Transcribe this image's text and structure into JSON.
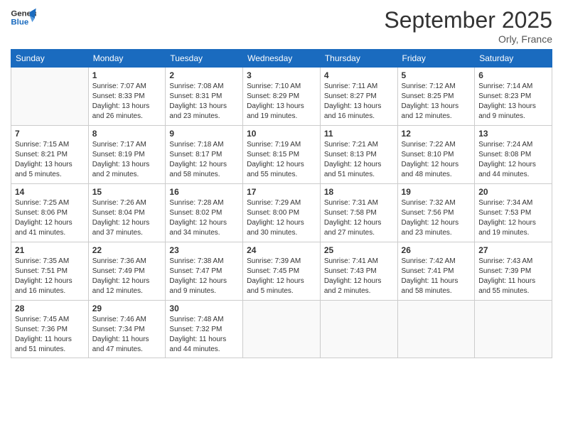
{
  "logo": {
    "line1": "General",
    "line2": "Blue"
  },
  "header": {
    "month": "September 2025",
    "location": "Orly, France"
  },
  "weekdays": [
    "Sunday",
    "Monday",
    "Tuesday",
    "Wednesday",
    "Thursday",
    "Friday",
    "Saturday"
  ],
  "weeks": [
    [
      {
        "day": "",
        "info": ""
      },
      {
        "day": "1",
        "info": "Sunrise: 7:07 AM\nSunset: 8:33 PM\nDaylight: 13 hours\nand 26 minutes."
      },
      {
        "day": "2",
        "info": "Sunrise: 7:08 AM\nSunset: 8:31 PM\nDaylight: 13 hours\nand 23 minutes."
      },
      {
        "day": "3",
        "info": "Sunrise: 7:10 AM\nSunset: 8:29 PM\nDaylight: 13 hours\nand 19 minutes."
      },
      {
        "day": "4",
        "info": "Sunrise: 7:11 AM\nSunset: 8:27 PM\nDaylight: 13 hours\nand 16 minutes."
      },
      {
        "day": "5",
        "info": "Sunrise: 7:12 AM\nSunset: 8:25 PM\nDaylight: 13 hours\nand 12 minutes."
      },
      {
        "day": "6",
        "info": "Sunrise: 7:14 AM\nSunset: 8:23 PM\nDaylight: 13 hours\nand 9 minutes."
      }
    ],
    [
      {
        "day": "7",
        "info": "Sunrise: 7:15 AM\nSunset: 8:21 PM\nDaylight: 13 hours\nand 5 minutes."
      },
      {
        "day": "8",
        "info": "Sunrise: 7:17 AM\nSunset: 8:19 PM\nDaylight: 13 hours\nand 2 minutes."
      },
      {
        "day": "9",
        "info": "Sunrise: 7:18 AM\nSunset: 8:17 PM\nDaylight: 12 hours\nand 58 minutes."
      },
      {
        "day": "10",
        "info": "Sunrise: 7:19 AM\nSunset: 8:15 PM\nDaylight: 12 hours\nand 55 minutes."
      },
      {
        "day": "11",
        "info": "Sunrise: 7:21 AM\nSunset: 8:13 PM\nDaylight: 12 hours\nand 51 minutes."
      },
      {
        "day": "12",
        "info": "Sunrise: 7:22 AM\nSunset: 8:10 PM\nDaylight: 12 hours\nand 48 minutes."
      },
      {
        "day": "13",
        "info": "Sunrise: 7:24 AM\nSunset: 8:08 PM\nDaylight: 12 hours\nand 44 minutes."
      }
    ],
    [
      {
        "day": "14",
        "info": "Sunrise: 7:25 AM\nSunset: 8:06 PM\nDaylight: 12 hours\nand 41 minutes."
      },
      {
        "day": "15",
        "info": "Sunrise: 7:26 AM\nSunset: 8:04 PM\nDaylight: 12 hours\nand 37 minutes."
      },
      {
        "day": "16",
        "info": "Sunrise: 7:28 AM\nSunset: 8:02 PM\nDaylight: 12 hours\nand 34 minutes."
      },
      {
        "day": "17",
        "info": "Sunrise: 7:29 AM\nSunset: 8:00 PM\nDaylight: 12 hours\nand 30 minutes."
      },
      {
        "day": "18",
        "info": "Sunrise: 7:31 AM\nSunset: 7:58 PM\nDaylight: 12 hours\nand 27 minutes."
      },
      {
        "day": "19",
        "info": "Sunrise: 7:32 AM\nSunset: 7:56 PM\nDaylight: 12 hours\nand 23 minutes."
      },
      {
        "day": "20",
        "info": "Sunrise: 7:34 AM\nSunset: 7:53 PM\nDaylight: 12 hours\nand 19 minutes."
      }
    ],
    [
      {
        "day": "21",
        "info": "Sunrise: 7:35 AM\nSunset: 7:51 PM\nDaylight: 12 hours\nand 16 minutes."
      },
      {
        "day": "22",
        "info": "Sunrise: 7:36 AM\nSunset: 7:49 PM\nDaylight: 12 hours\nand 12 minutes."
      },
      {
        "day": "23",
        "info": "Sunrise: 7:38 AM\nSunset: 7:47 PM\nDaylight: 12 hours\nand 9 minutes."
      },
      {
        "day": "24",
        "info": "Sunrise: 7:39 AM\nSunset: 7:45 PM\nDaylight: 12 hours\nand 5 minutes."
      },
      {
        "day": "25",
        "info": "Sunrise: 7:41 AM\nSunset: 7:43 PM\nDaylight: 12 hours\nand 2 minutes."
      },
      {
        "day": "26",
        "info": "Sunrise: 7:42 AM\nSunset: 7:41 PM\nDaylight: 11 hours\nand 58 minutes."
      },
      {
        "day": "27",
        "info": "Sunrise: 7:43 AM\nSunset: 7:39 PM\nDaylight: 11 hours\nand 55 minutes."
      }
    ],
    [
      {
        "day": "28",
        "info": "Sunrise: 7:45 AM\nSunset: 7:36 PM\nDaylight: 11 hours\nand 51 minutes."
      },
      {
        "day": "29",
        "info": "Sunrise: 7:46 AM\nSunset: 7:34 PM\nDaylight: 11 hours\nand 47 minutes."
      },
      {
        "day": "30",
        "info": "Sunrise: 7:48 AM\nSunset: 7:32 PM\nDaylight: 11 hours\nand 44 minutes."
      },
      {
        "day": "",
        "info": ""
      },
      {
        "day": "",
        "info": ""
      },
      {
        "day": "",
        "info": ""
      },
      {
        "day": "",
        "info": ""
      }
    ]
  ]
}
